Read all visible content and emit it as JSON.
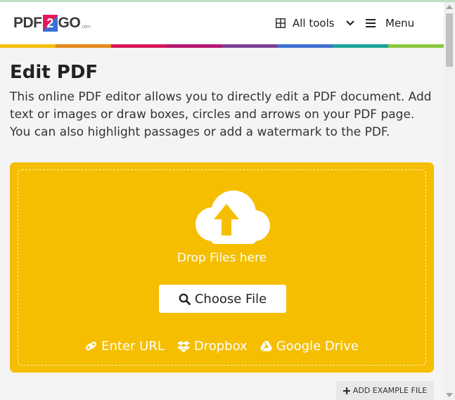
{
  "header": {
    "logo_prefix": "PDF",
    "logo_two": "2",
    "logo_suffix": "GO",
    "logo_com": ".com",
    "all_tools_label": "All tools",
    "menu_label": "Menu",
    "color_bar": [
      "#f5be00",
      "#e6891a",
      "#d8155a",
      "#b6166f",
      "#7b3f98",
      "#3b6fd0",
      "#1aa39a",
      "#8cc63f"
    ]
  },
  "page": {
    "title": "Edit PDF",
    "description": "This online PDF editor allows you to directly edit a PDF document. Add text or images or draw boxes, circles and arrows on your PDF page. You can also highlight passages or add a watermark to the PDF."
  },
  "upload": {
    "drop_text": "Drop Files here",
    "choose_label": "Choose File",
    "enter_url_label": "Enter URL",
    "dropbox_label": "Dropbox",
    "google_drive_label": "Google Drive",
    "accent": "#f5be00"
  },
  "example": {
    "label": "ADD EXAMPLE FILE"
  },
  "icons": [
    "grid-icon",
    "chevron-down-icon",
    "hamburger-icon",
    "cloud-upload-icon",
    "search-icon",
    "link-icon",
    "dropbox-icon",
    "google-drive-icon",
    "plus-icon"
  ]
}
